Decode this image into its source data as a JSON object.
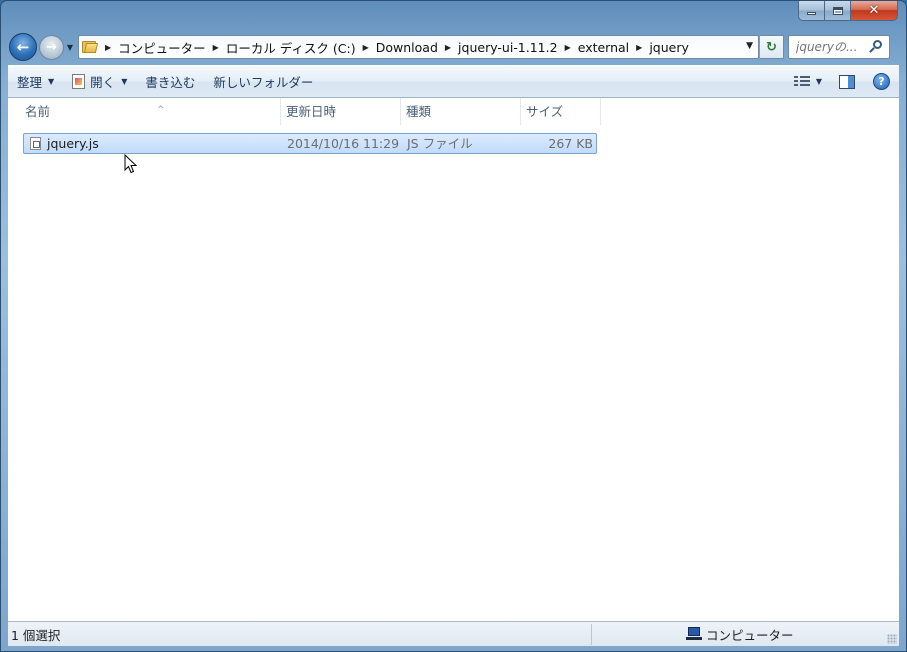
{
  "window": {
    "title": "",
    "caption": {
      "minimize_glyph": "",
      "maximize_glyph": "",
      "close_glyph": "✕"
    }
  },
  "nav": {
    "back_glyph": "←",
    "forward_glyph": "→",
    "history_glyph": "▼",
    "breadcrumb": [
      "コンピューター",
      "ローカル ディスク (C:)",
      "Download",
      "jquery-ui-1.11.2",
      "external",
      "jquery"
    ],
    "crumb_arrow": "▶",
    "address_drop_glyph": "▼",
    "refresh_glyph": "↻",
    "search_placeholder": "jqueryの..."
  },
  "toolbar": {
    "organize_label": "整理",
    "open_label": "開く",
    "burn_label": "書き込む",
    "new_folder_label": "新しいフォルダー",
    "drop_glyph": "▼",
    "help_glyph": "?"
  },
  "columns": {
    "name": "名前",
    "modified": "更新日時",
    "type": "種類",
    "size": "サイズ",
    "sort_glyph": "^"
  },
  "files": [
    {
      "name": "jquery.js",
      "modified": "2014/10/16 11:29",
      "type": "JS ファイル",
      "size": "267 KB",
      "selected": true
    }
  ],
  "status": {
    "count": "1 個選択",
    "location": "コンピューター"
  },
  "colors": {
    "selection_fill": "#c1dcfc",
    "selection_border": "#7da2ce",
    "header_text": "#4c607a",
    "details_text": "#6d6d6d",
    "command_text": "#1e395b"
  }
}
